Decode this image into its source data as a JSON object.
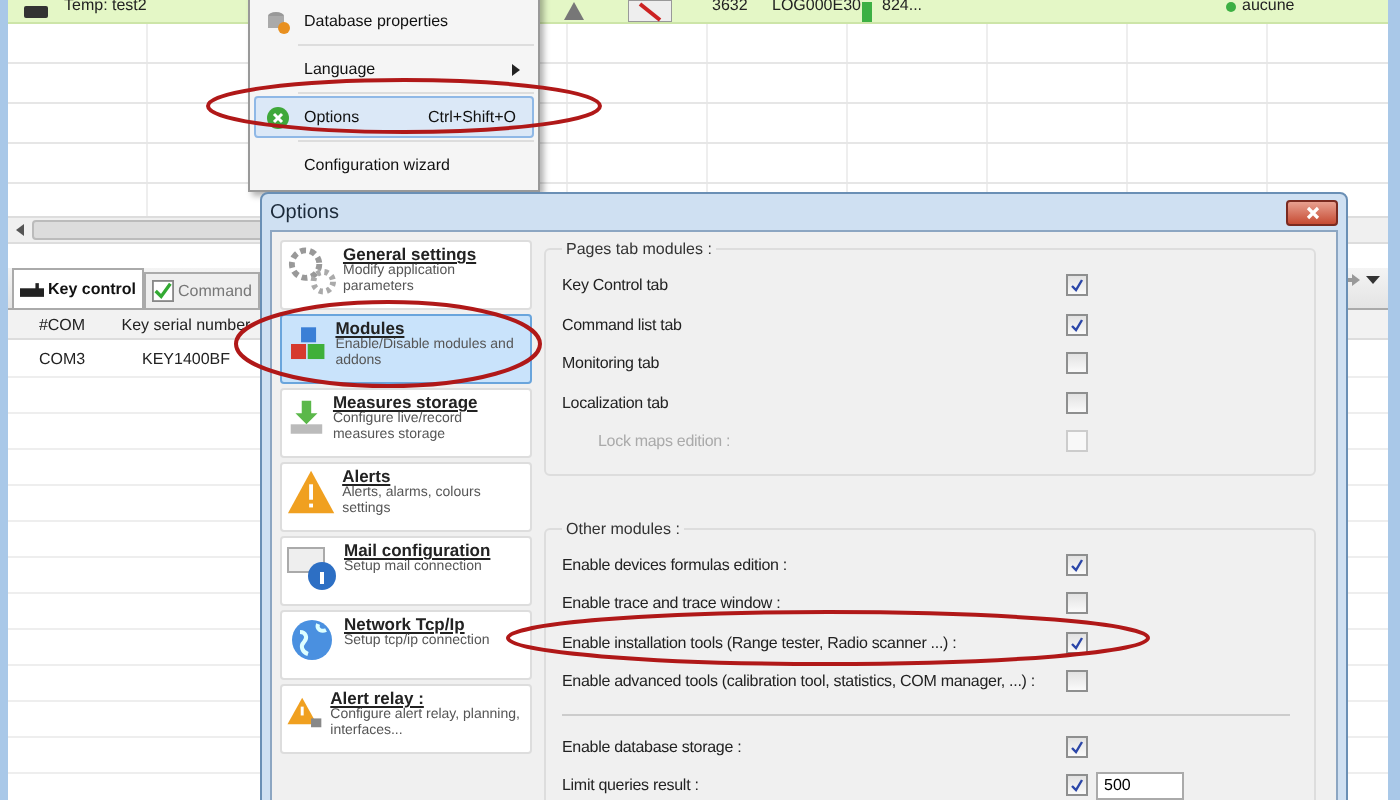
{
  "grid_row": {
    "name": "Temp: test2",
    "cells": [
      "3632",
      "LOG000E30",
      "824..."
    ],
    "status": {
      "text": "aucune",
      "color": "#3cb043"
    }
  },
  "context_menu": {
    "items": [
      {
        "label": "Database properties",
        "kind": "item",
        "selected": false
      },
      {
        "label": "Language",
        "kind": "submenu",
        "selected": false
      },
      {
        "label": "Options",
        "shortcut": "Ctrl+Shift+O",
        "kind": "item",
        "selected": true
      },
      {
        "label": "Configuration wizard",
        "kind": "item",
        "selected": false
      }
    ]
  },
  "bottom_tabs": [
    {
      "label": "Key control",
      "selected": true
    },
    {
      "label": "Command",
      "selected": false
    }
  ],
  "key_table": {
    "columns": [
      "#COM",
      "Key serial number"
    ],
    "rows": [
      [
        "COM3",
        "KEY1400BF"
      ]
    ]
  },
  "dialog": {
    "title": "Options",
    "categories": [
      {
        "title": "General settings",
        "description": "Modify application parameters",
        "kind": "gears",
        "selected": false
      },
      {
        "title": "Modules",
        "description": "Enable/Disable modules and addons",
        "kind": "blocks",
        "selected": true
      },
      {
        "title": "Measures storage",
        "description": "Configure live/record measures storage",
        "kind": "download",
        "selected": false
      },
      {
        "title": "Alerts",
        "description": "Alerts, alarms, colours settings",
        "kind": "warning",
        "selected": false
      },
      {
        "title": "Mail configuration",
        "description": "Setup mail connection",
        "kind": "mail",
        "selected": false
      },
      {
        "title": "Network Tcp/Ip",
        "description": "Setup tcp/ip connection",
        "kind": "globe",
        "selected": false
      },
      {
        "title": "Alert relay :",
        "description": "Configure alert relay, planning, interfaces...",
        "kind": "relay",
        "selected": false
      }
    ],
    "groups": [
      {
        "title": "Pages tab modules :",
        "options": [
          {
            "kind": "checkbox",
            "label": "Key Control tab",
            "checked": true,
            "disabled": false
          },
          {
            "kind": "checkbox",
            "label": "Command list tab",
            "checked": true,
            "disabled": false
          },
          {
            "kind": "checkbox",
            "label": "Monitoring tab",
            "checked": false,
            "disabled": false
          },
          {
            "kind": "checkbox",
            "label": "Localization tab",
            "checked": false,
            "disabled": false,
            "children": [
              {
                "kind": "checkbox",
                "label": "Lock maps edition :",
                "checked": false,
                "disabled": true
              }
            ]
          }
        ]
      },
      {
        "title": "Other modules :",
        "options": [
          {
            "kind": "checkbox",
            "label": "Enable devices formulas edition :",
            "checked": true,
            "disabled": false
          },
          {
            "kind": "checkbox",
            "label": "Enable trace and trace window :",
            "checked": false,
            "disabled": false
          },
          {
            "kind": "checkbox",
            "label": "Enable installation tools (Range tester, Radio scanner ...) :",
            "checked": true,
            "disabled": false
          },
          {
            "kind": "checkbox",
            "label": "Enable advanced tools (calibration tool, statistics, COM manager, ...) :",
            "checked": false,
            "disabled": false
          },
          {
            "kind": "separator"
          },
          {
            "kind": "checkbox",
            "label": "Enable database storage :",
            "checked": true,
            "disabled": false
          },
          {
            "kind": "checkbox_value",
            "label": "Limit queries result :",
            "checked": true,
            "disabled": false,
            "value": "500"
          }
        ]
      }
    ]
  }
}
